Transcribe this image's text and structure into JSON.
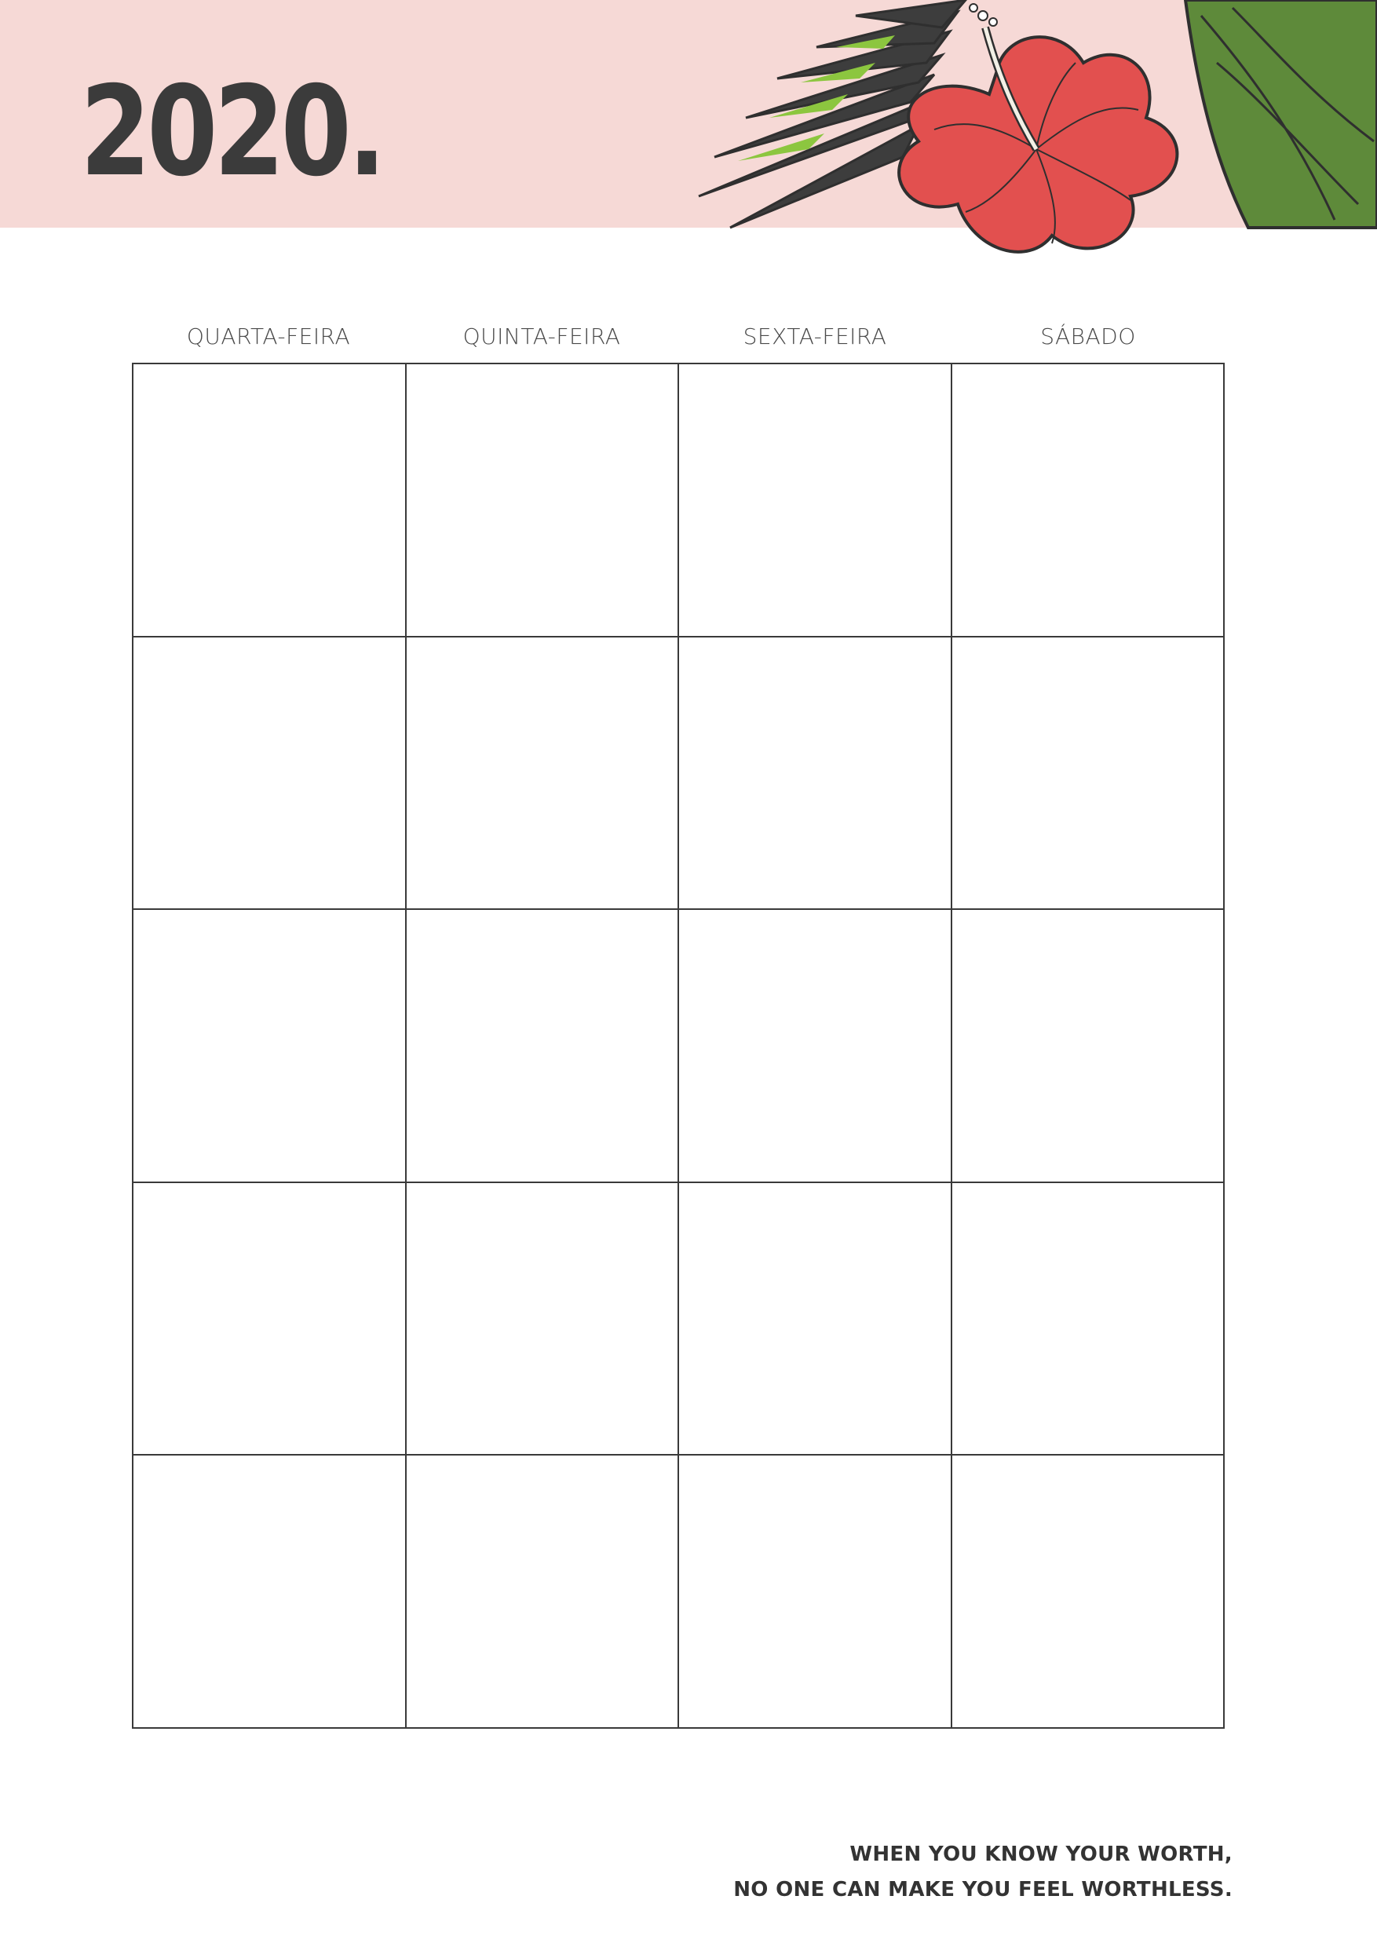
{
  "header": {
    "year": "2020.",
    "illustration_icon": "hibiscus-palm-leaf-illustration"
  },
  "colors": {
    "band": "#f6d9d6",
    "text": "#3b3b3b",
    "flower": "#e2504f",
    "leaf": "#5e8a3a",
    "leaf_light": "#8cc63f"
  },
  "weekdays": [
    "QUARTA-FEIRA",
    "QUINTA-FEIRA",
    "SEXTA-FEIRA",
    "SÁBADO"
  ],
  "grid": {
    "rows": 5,
    "columns": 4
  },
  "quote": {
    "line1": "WHEN YOU KNOW YOUR WORTH,",
    "line2": "NO ONE CAN MAKE YOU FEEL WORTHLESS."
  }
}
